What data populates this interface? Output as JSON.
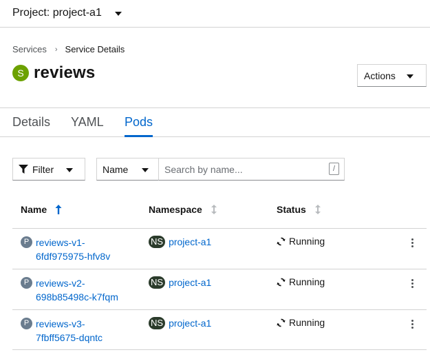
{
  "project": {
    "label": "Project: project-a1"
  },
  "breadcrumb": {
    "parent": "Services",
    "separator": "›",
    "current": "Service Details"
  },
  "resource": {
    "badge": "S",
    "name": "reviews",
    "badge_color": "#6ca100"
  },
  "actions": {
    "label": "Actions"
  },
  "tabs": [
    {
      "label": "Details"
    },
    {
      "label": "YAML"
    },
    {
      "label": "Pods"
    }
  ],
  "active_tab": "Pods",
  "filter": {
    "button_label": "Filter",
    "field_label": "Name",
    "search_placeholder": "Search by name...",
    "shortcut": "/"
  },
  "table": {
    "columns": [
      {
        "label": "Name"
      },
      {
        "label": "Namespace"
      },
      {
        "label": "Status"
      }
    ],
    "rows": [
      {
        "pod_badge": "P",
        "name_line1": "reviews-v1-",
        "name_line2": "6fdf975975-hfv8v",
        "ns_badge": "NS",
        "namespace": "project-a1",
        "status": "Running"
      },
      {
        "pod_badge": "P",
        "name_line1": "reviews-v2-",
        "name_line2": "698b85498c-k7fqm",
        "ns_badge": "NS",
        "namespace": "project-a1",
        "status": "Running"
      },
      {
        "pod_badge": "P",
        "name_line1": "reviews-v3-",
        "name_line2": "7fbff5675-dqntc",
        "ns_badge": "NS",
        "namespace": "project-a1",
        "status": "Running"
      }
    ]
  },
  "colors": {
    "link": "#0066cc",
    "ns_badge": "#2b3b2b",
    "pod_badge": "#6a7c8e"
  }
}
